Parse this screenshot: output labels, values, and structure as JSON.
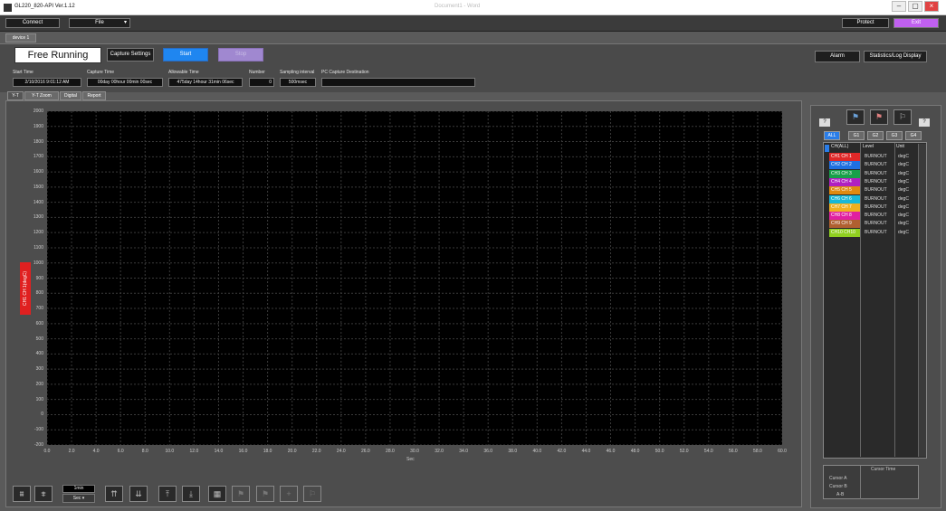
{
  "window": {
    "app_title": "GL220_820-API Ver.1.12",
    "doc_title": "Document1 - Word"
  },
  "menu": {
    "connect": "Connect",
    "file": "File",
    "protect": "Protect",
    "exit": "Exit"
  },
  "device_tab": "device 1",
  "status": {
    "mode": "Free Running",
    "capture_settings": "Capture Settings",
    "start": "Start",
    "stop": "Stop",
    "alarm": "Alarm",
    "statistics": "Statistics/Log Display"
  },
  "info": {
    "start_time_label": "Start Time",
    "start_time": "2/10/2016 9:01:12 AM",
    "capture_time_label": "Capture Time",
    "capture_time": "00day 00hour 00min 00sec",
    "allowable_time_label": "Allowable Time",
    "allowable_time": "475day 14hour 31min 06sec",
    "number_label": "Number",
    "number": "0",
    "interval_label": "Sampling interval",
    "interval": "500msec",
    "destination_label": "PC Capture Destination",
    "destination": ""
  },
  "view_tabs": [
    "Y-T",
    "Y-T Zoom",
    "Digital",
    "Report"
  ],
  "chart_data": {
    "type": "line",
    "ylabel": "CH1 CH 1(degC)",
    "xlabel": "Sec",
    "ylim": [
      -200,
      2000
    ],
    "xlim": [
      0,
      60
    ],
    "y_ticks": [
      "2000",
      "1900",
      "1800",
      "1700",
      "1600",
      "1500",
      "1400",
      "1300",
      "1200",
      "1100",
      "1000",
      "900",
      "800",
      "700",
      "600",
      "500",
      "400",
      "300",
      "200",
      "100",
      "0",
      "-100",
      "-200"
    ],
    "x_ticks": [
      "0.0",
      "2.0",
      "4.0",
      "6.0",
      "8.0",
      "10.0",
      "12.0",
      "14.0",
      "16.0",
      "18.0",
      "20.0",
      "22.0",
      "24.0",
      "26.0",
      "28.0",
      "30.0",
      "32.0",
      "34.0",
      "36.0",
      "38.0",
      "40.0",
      "42.0",
      "44.0",
      "46.0",
      "48.0",
      "50.0",
      "52.0",
      "54.0",
      "56.0",
      "58.0",
      "60.0"
    ],
    "grid": true,
    "series": []
  },
  "toolbar": {
    "span_value": "1min",
    "span_unit": "Sec"
  },
  "side": {
    "groups": [
      "ALL",
      "G1",
      "G2",
      "G3",
      "G4"
    ],
    "headers": [
      "CH(ALL)",
      "Level",
      "Unit"
    ],
    "channels": [
      {
        "name": "CH1 CH 1",
        "level": "BURNOUT",
        "unit": "degC",
        "color": "#e02828"
      },
      {
        "name": "CH2 CH 2",
        "level": "BURNOUT",
        "unit": "degC",
        "color": "#1f6fe0"
      },
      {
        "name": "CH3 CH 3",
        "level": "BURNOUT",
        "unit": "degC",
        "color": "#18a04a"
      },
      {
        "name": "CH4 CH 4",
        "level": "BURNOUT",
        "unit": "degC",
        "color": "#b020c0"
      },
      {
        "name": "CH5 CH 5",
        "level": "BURNOUT",
        "unit": "degC",
        "color": "#e08a10"
      },
      {
        "name": "CH6 CH 6",
        "level": "BURNOUT",
        "unit": "degC",
        "color": "#18b8d8"
      },
      {
        "name": "CH7 CH 7",
        "level": "BURNOUT",
        "unit": "degC",
        "color": "#f0b020"
      },
      {
        "name": "CH8 CH 8",
        "level": "BURNOUT",
        "unit": "degC",
        "color": "#e020a0"
      },
      {
        "name": "CH9 CH 9",
        "level": "BURNOUT",
        "unit": "degC",
        "color": "#b06030"
      },
      {
        "name": "CH10 CH10",
        "level": "BURNOUT",
        "unit": "degC",
        "color": "#90d020"
      }
    ],
    "cursor_header": "Cursor Time",
    "cursor_a": "Cursor A",
    "cursor_b": "Cursor B",
    "cursor_diff": "A-B"
  }
}
